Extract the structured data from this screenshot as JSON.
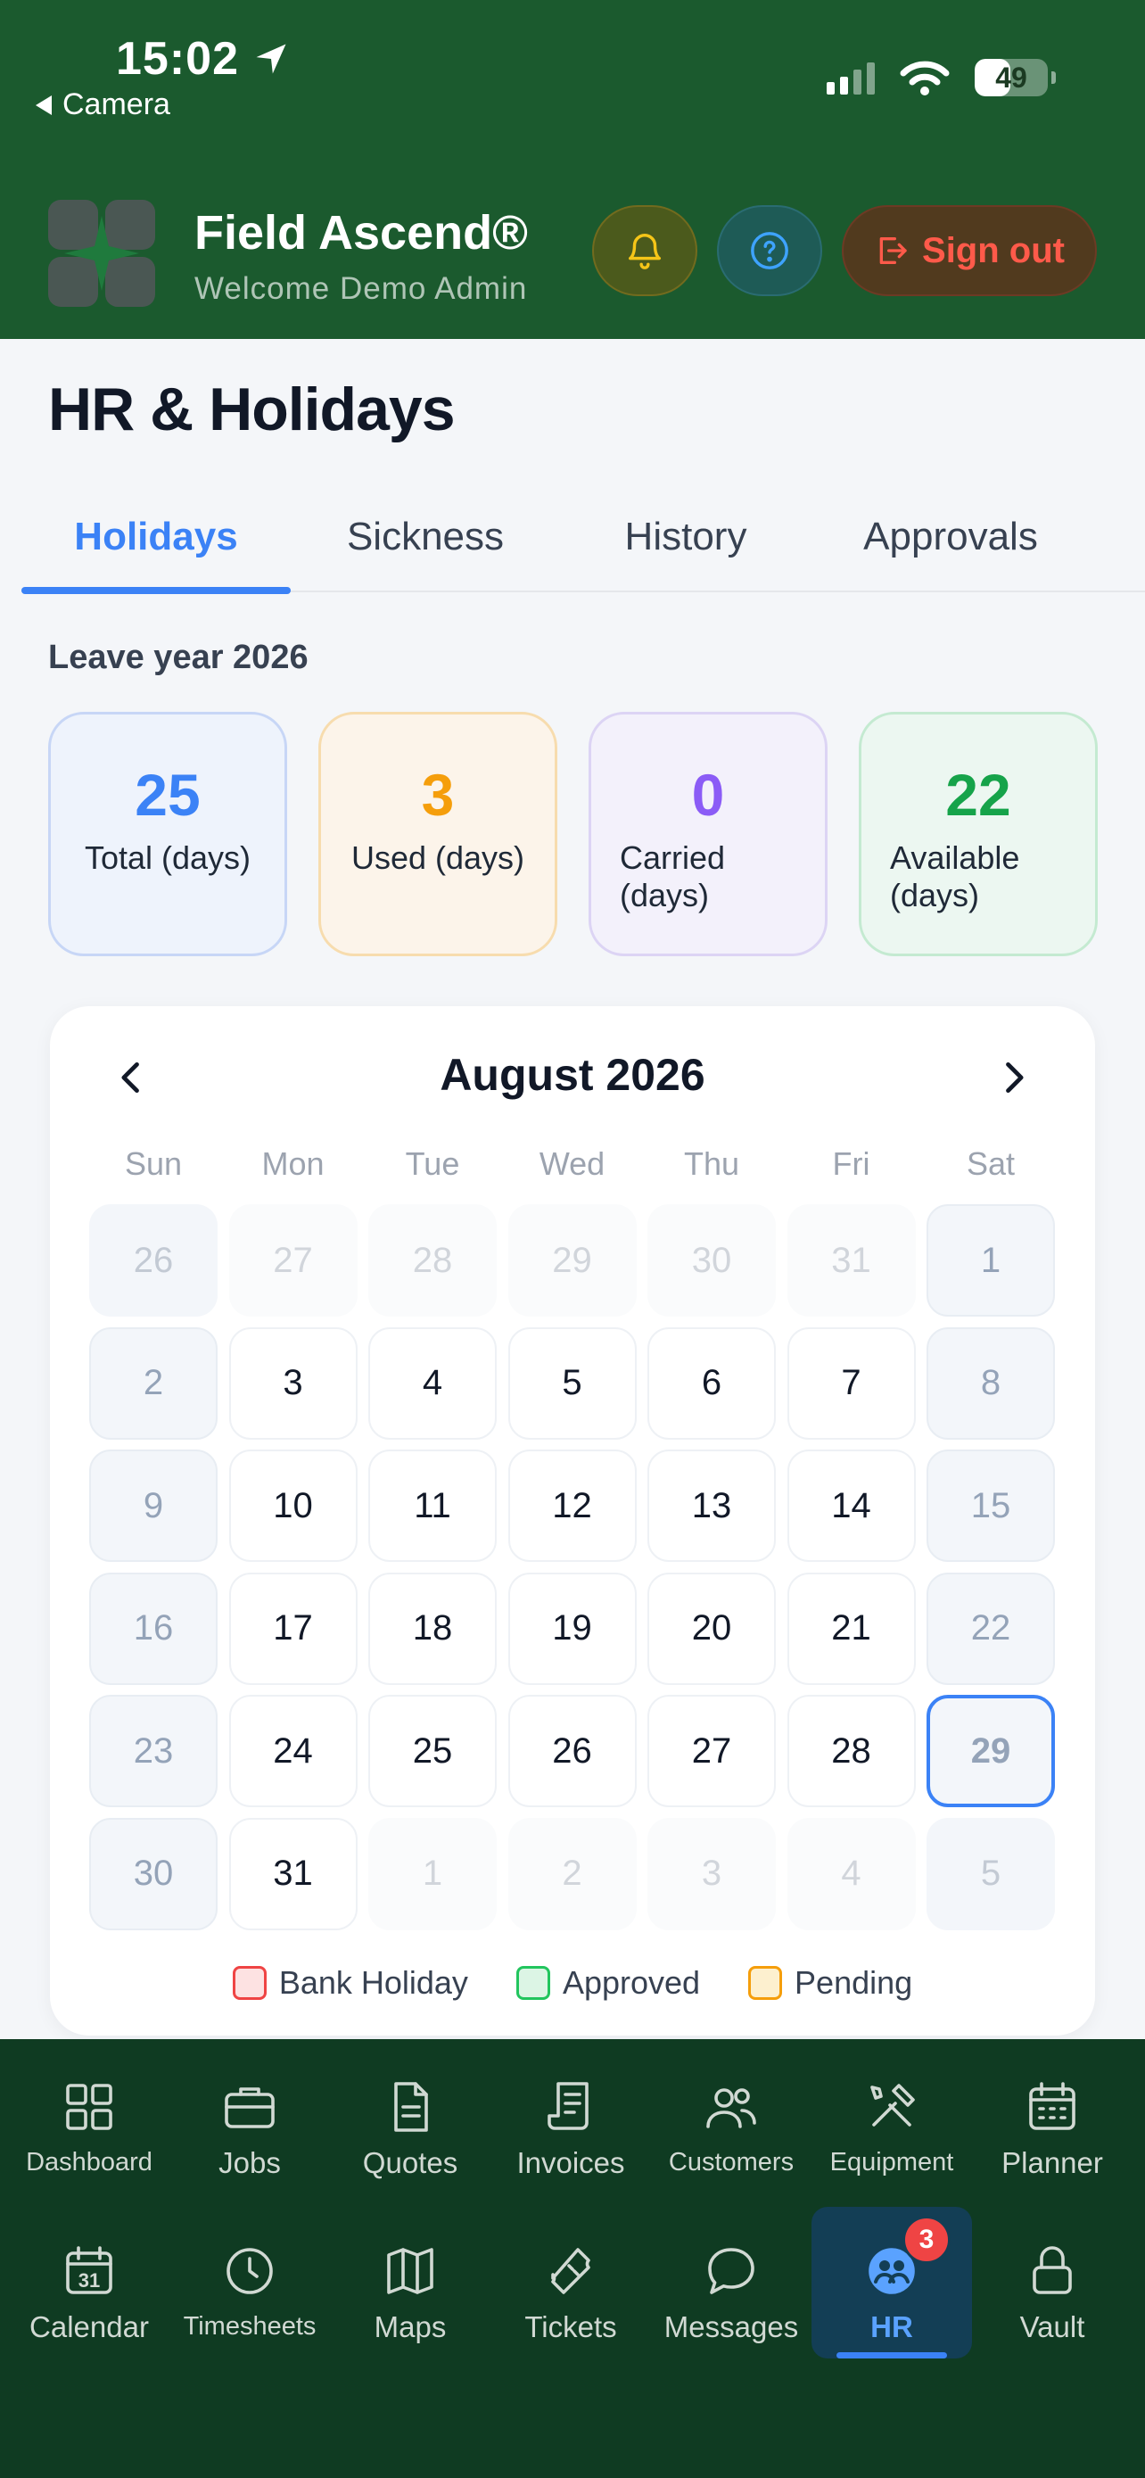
{
  "status_bar": {
    "time": "15:02",
    "back_label": "Camera",
    "battery": "49",
    "battery_level": 0.49
  },
  "header": {
    "brand": "Field Ascend®",
    "welcome": "Welcome Demo Admin",
    "sign_out_label": "Sign out",
    "colors": {
      "bar": "#1b5a2e",
      "sign_out": "#ff5a4a"
    }
  },
  "page": {
    "title": "HR & Holidays",
    "tabs": [
      {
        "label": "Holidays",
        "active": true
      },
      {
        "label": "Sickness",
        "active": false
      },
      {
        "label": "History",
        "active": false
      },
      {
        "label": "Approvals",
        "active": false
      }
    ]
  },
  "leave": {
    "year_label": "Leave year 2026",
    "stats": [
      {
        "value": "25",
        "label": "Total (days)",
        "color": "#3b82f6",
        "border": "#c7d6f6",
        "bg": "#eef3fc"
      },
      {
        "value": "3",
        "label": "Used (days)",
        "color": "#f59e0b",
        "border": "#f7dcae",
        "bg": "#fcf4ea"
      },
      {
        "value": "0",
        "label": "Carried (days)",
        "color": "#8b5cf6",
        "border": "#dcd4f4",
        "bg": "#f3f1fb"
      },
      {
        "value": "22",
        "label": "Available (days)",
        "color": "#16a34a",
        "border": "#c4ead1",
        "bg": "#ecf7f1"
      }
    ]
  },
  "calendar": {
    "month": "August 2026",
    "weekdays": [
      "Sun",
      "Mon",
      "Tue",
      "Wed",
      "Thu",
      "Fri",
      "Sat"
    ],
    "weeks": [
      [
        "26",
        "27",
        "28",
        "29",
        "30",
        "31",
        "1"
      ],
      [
        "2",
        "3",
        "4",
        "5",
        "6",
        "7",
        "8"
      ],
      [
        "9",
        "10",
        "11",
        "12",
        "13",
        "14",
        "15"
      ],
      [
        "16",
        "17",
        "18",
        "19",
        "20",
        "21",
        "22"
      ],
      [
        "23",
        "24",
        "25",
        "26",
        "27",
        "28",
        "29"
      ],
      [
        "30",
        "31",
        "1",
        "2",
        "3",
        "4",
        "5"
      ]
    ],
    "today": "29",
    "legend": [
      {
        "label": "Bank Holiday",
        "fill": "#fde2e2",
        "stroke": "#ef4444"
      },
      {
        "label": "Approved",
        "fill": "#dcf5e5",
        "stroke": "#22c55e"
      },
      {
        "label": "Pending",
        "fill": "#fdf0cf",
        "stroke": "#f59e0b"
      }
    ]
  },
  "bottom_nav": {
    "items": [
      {
        "label": "Dashboard",
        "icon": "grid-icon"
      },
      {
        "label": "Jobs",
        "icon": "briefcase-icon"
      },
      {
        "label": "Quotes",
        "icon": "document-icon"
      },
      {
        "label": "Invoices",
        "icon": "receipt-icon"
      },
      {
        "label": "Customers",
        "icon": "users-icon"
      },
      {
        "label": "Equipment",
        "icon": "tools-icon"
      },
      {
        "label": "Planner",
        "icon": "planner-icon"
      },
      {
        "label": "Calendar",
        "icon": "calendar-icon",
        "calendar_day": "31"
      },
      {
        "label": "Timesheets",
        "icon": "clock-icon"
      },
      {
        "label": "Maps",
        "icon": "map-icon"
      },
      {
        "label": "Tickets",
        "icon": "ticket-icon"
      },
      {
        "label": "Messages",
        "icon": "chat-icon"
      },
      {
        "label": "HR",
        "icon": "hr-users-icon",
        "badge": "3",
        "active": true
      },
      {
        "label": "Vault",
        "icon": "lock-icon"
      }
    ]
  }
}
